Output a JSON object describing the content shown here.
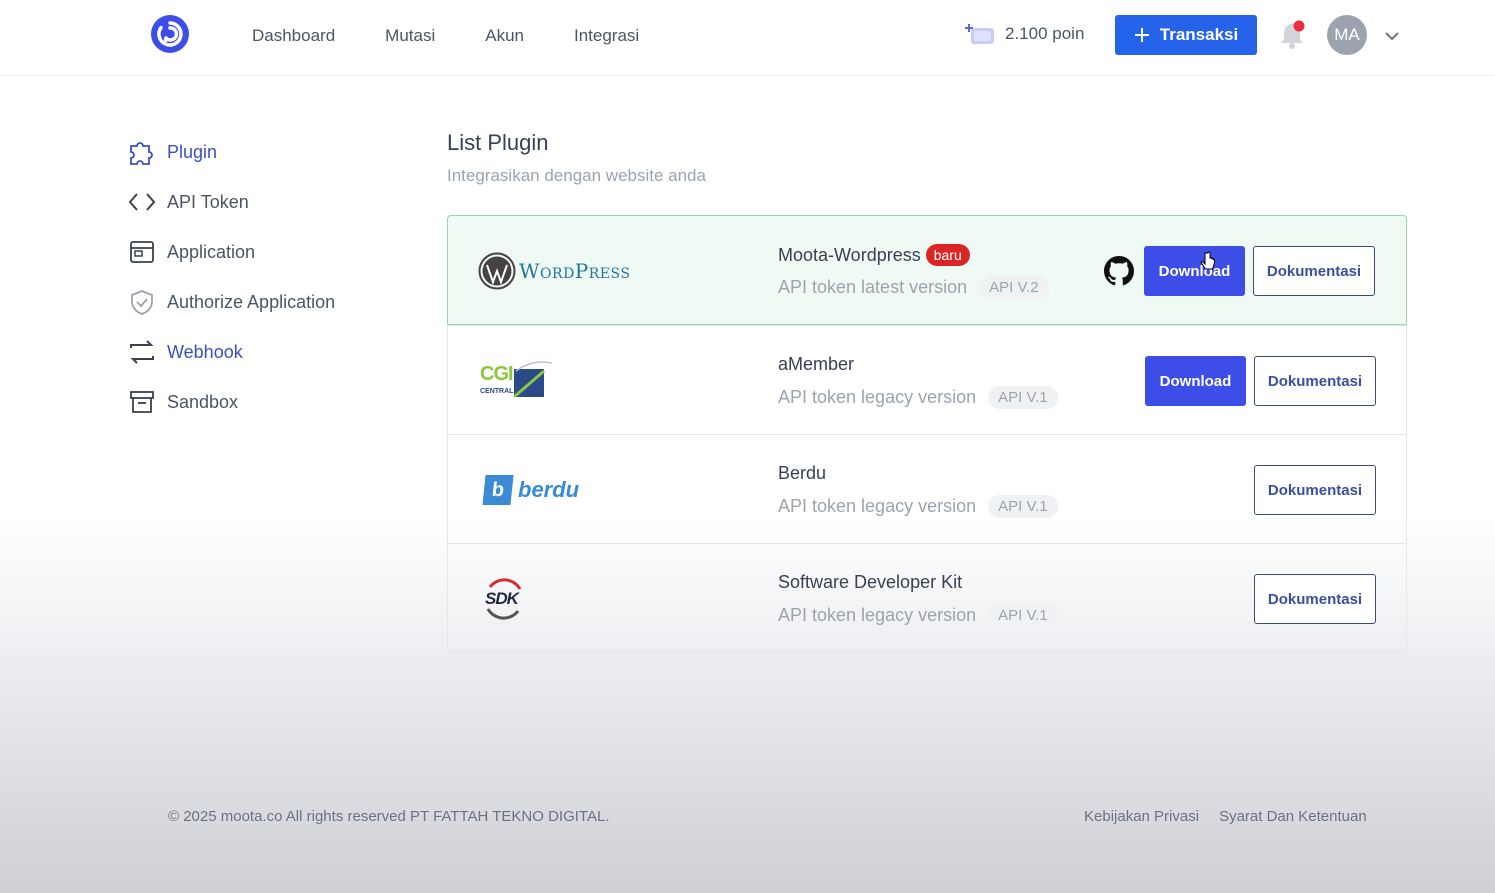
{
  "brand": {
    "logo_icon": "moota-logo-icon",
    "accent": "#2563eb"
  },
  "nav": {
    "items": [
      "Dashboard",
      "Mutasi",
      "Akun",
      "Integrasi"
    ]
  },
  "header": {
    "points": "2.100 poin",
    "points_icon": "card-plus-icon",
    "transaction_button": "Transaksi",
    "avatar_initials": "MA",
    "notification_dot_color": "#ef2b3c"
  },
  "sidebar": {
    "items": [
      {
        "label": "Plugin",
        "icon": "puzzle-icon",
        "active": true
      },
      {
        "label": "API Token",
        "icon": "code-icon",
        "active": false
      },
      {
        "label": "Application",
        "icon": "window-icon",
        "active": false
      },
      {
        "label": "Authorize Application",
        "icon": "shield-check-icon",
        "active": false
      },
      {
        "label": "Webhook",
        "icon": "swap-arrows-icon",
        "active": true
      },
      {
        "label": "Sandbox",
        "icon": "archive-box-icon",
        "active": false
      }
    ]
  },
  "main": {
    "title": "List Plugin",
    "subtitle": "Integrasikan dengan website anda",
    "plugins": [
      {
        "name": "Moota-Wordpress",
        "badge": "baru",
        "desc": "API token latest version",
        "api": "API V.2",
        "logo": "wordpress-logo",
        "logo_text": "WordPress",
        "download": "Download",
        "doc": "Dokumentasi",
        "github_icon": "github-icon"
      },
      {
        "name": "aMember",
        "desc": "API token legacy version",
        "api": "API V.1",
        "logo": "cgi-central-logo",
        "logo_text": "CGI",
        "logo_subtext": "CENTRAL",
        "download": "Download",
        "doc": "Dokumentasi"
      },
      {
        "name": "Berdu",
        "desc": "API token legacy version",
        "api": "API V.1",
        "logo": "berdu-logo",
        "logo_text": "berdu",
        "logo_letter": "b",
        "doc": "Dokumentasi"
      },
      {
        "name": "Software Developer Kit",
        "desc": "API token legacy version",
        "api": "API V.1",
        "logo": "sdk-logo",
        "logo_text": "SDK",
        "doc": "Dokumentasi"
      }
    ]
  },
  "footer": {
    "copyright": "© 2025 moota.co All rights reserved PT FATTAH TEKNO DIGITAL.",
    "links": [
      "Kebijakan Privasi",
      "Syarat Dan Ketentuan"
    ]
  }
}
